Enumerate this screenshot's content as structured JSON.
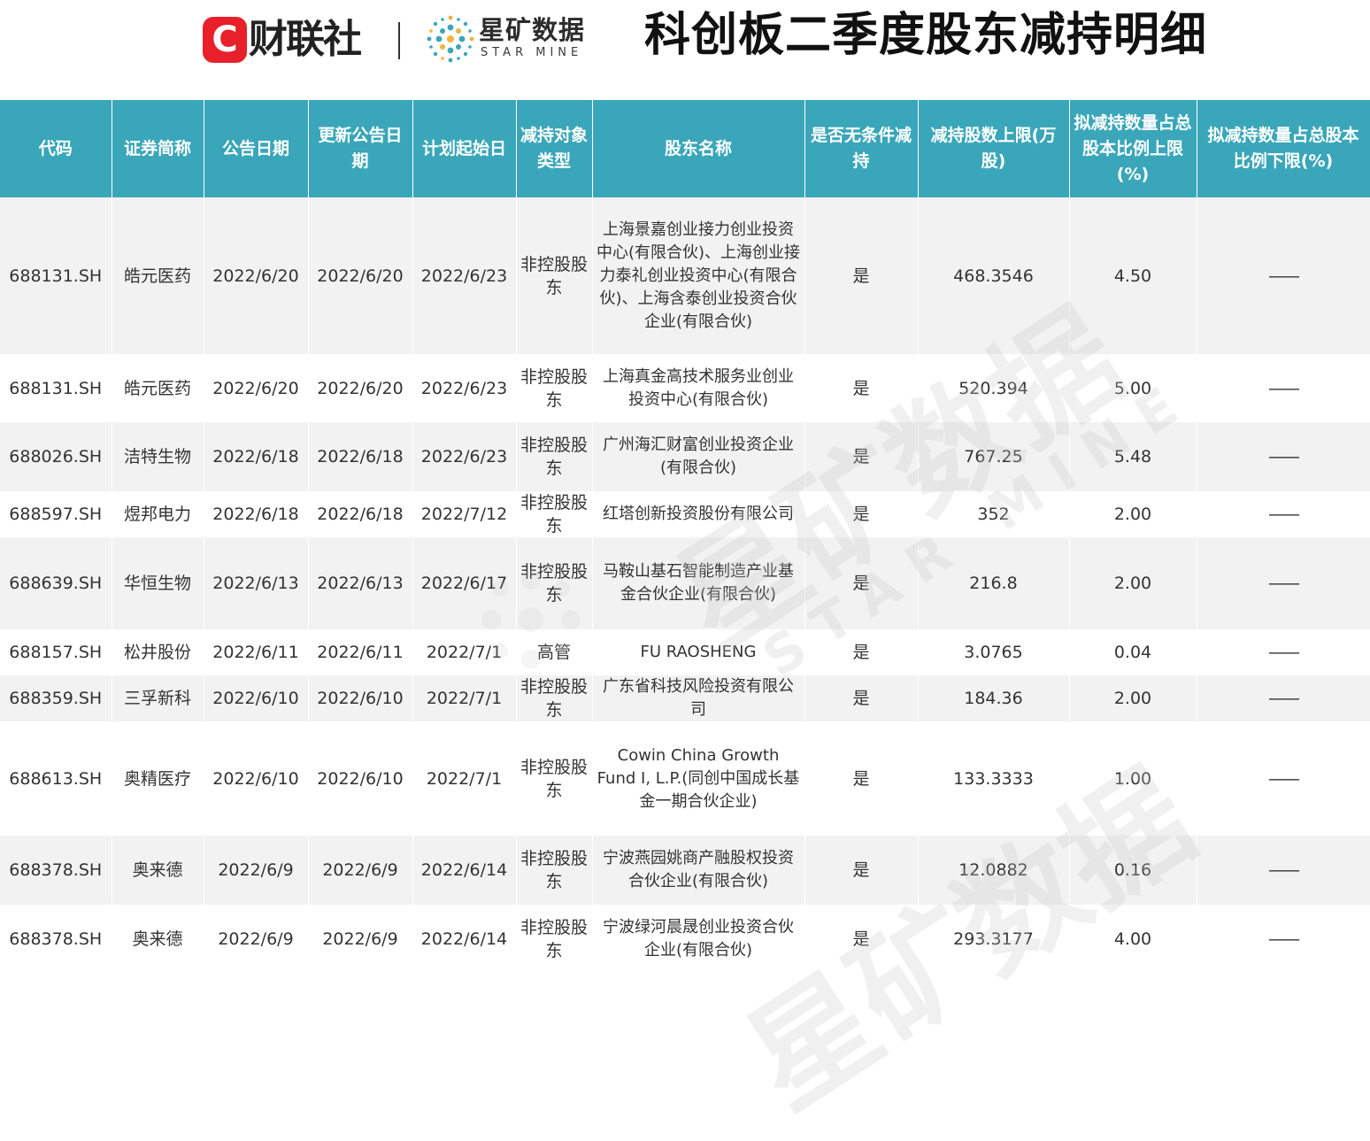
{
  "header": {
    "logo_c": "C",
    "logo_text": "财联社",
    "starmine_cn": "星矿数据",
    "starmine_en": "STAR MINE",
    "title": "科创板二季度股东减持明细"
  },
  "colors": {
    "header_bg": "#3aa6b9",
    "row_alt": "#f2f2f2",
    "logo_red": "#e8202a"
  },
  "table": {
    "columns": [
      "代码",
      "证券简称",
      "公告日期",
      "更新公告日期",
      "计划起始日",
      "减持对象类型",
      "股东名称",
      "是否无条件减持",
      "减持股数上限(万股)",
      "拟减持数量占总股本比例上限(%)",
      "拟减持数量占总股本比例下限(%)"
    ],
    "rows": [
      {
        "code": "688131.SH",
        "name": "皓元医药",
        "announce": "2022/6/20",
        "update": "2022/6/20",
        "start": "2022/6/23",
        "type": "非控股股东",
        "holder": "上海景嘉创业接力创业投资中心(有限合伙)、上海创业接力泰礼创业投资中心(有限合伙)、上海含泰创业投资合伙企业(有限合伙)",
        "unconditional": "是",
        "max_shares": "468.3546",
        "ratio_upper": "4.50",
        "ratio_lower": "——"
      },
      {
        "code": "688131.SH",
        "name": "皓元医药",
        "announce": "2022/6/20",
        "update": "2022/6/20",
        "start": "2022/6/23",
        "type": "非控股股东",
        "holder": "上海真金高技术服务业创业投资中心(有限合伙)",
        "unconditional": "是",
        "max_shares": "520.394",
        "ratio_upper": "5.00",
        "ratio_lower": "——"
      },
      {
        "code": "688026.SH",
        "name": "洁特生物",
        "announce": "2022/6/18",
        "update": "2022/6/18",
        "start": "2022/6/23",
        "type": "非控股股东",
        "holder": "广州海汇财富创业投资企业(有限合伙)",
        "unconditional": "是",
        "max_shares": "767.25",
        "ratio_upper": "5.48",
        "ratio_lower": "——"
      },
      {
        "code": "688597.SH",
        "name": "煜邦电力",
        "announce": "2022/6/18",
        "update": "2022/6/18",
        "start": "2022/7/12",
        "type": "非控股股东",
        "holder": "红塔创新投资股份有限公司",
        "unconditional": "是",
        "max_shares": "352",
        "ratio_upper": "2.00",
        "ratio_lower": "——"
      },
      {
        "code": "688639.SH",
        "name": "华恒生物",
        "announce": "2022/6/13",
        "update": "2022/6/13",
        "start": "2022/6/17",
        "type": "非控股股东",
        "holder": "马鞍山基石智能制造产业基金合伙企业(有限合伙)",
        "unconditional": "是",
        "max_shares": "216.8",
        "ratio_upper": "2.00",
        "ratio_lower": "——"
      },
      {
        "code": "688157.SH",
        "name": "松井股份",
        "announce": "2022/6/11",
        "update": "2022/6/11",
        "start": "2022/7/1",
        "type": "高管",
        "holder": "FU RAOSHENG",
        "unconditional": "是",
        "max_shares": "3.0765",
        "ratio_upper": "0.04",
        "ratio_lower": "——"
      },
      {
        "code": "688359.SH",
        "name": "三孚新科",
        "announce": "2022/6/10",
        "update": "2022/6/10",
        "start": "2022/7/1",
        "type": "非控股股东",
        "holder": "广东省科技风险投资有限公司",
        "unconditional": "是",
        "max_shares": "184.36",
        "ratio_upper": "2.00",
        "ratio_lower": "——"
      },
      {
        "code": "688613.SH",
        "name": "奥精医疗",
        "announce": "2022/6/10",
        "update": "2022/6/10",
        "start": "2022/7/1",
        "type": "非控股股东",
        "holder": "Cowin China Growth Fund I, L.P.(同创中国成长基金一期合伙企业)",
        "unconditional": "是",
        "max_shares": "133.3333",
        "ratio_upper": "1.00",
        "ratio_lower": "——"
      },
      {
        "code": "688378.SH",
        "name": "奥来德",
        "announce": "2022/6/9",
        "update": "2022/6/9",
        "start": "2022/6/14",
        "type": "非控股股东",
        "holder": "宁波燕园姚商产融股权投资合伙企业(有限合伙)",
        "unconditional": "是",
        "max_shares": "12.0882",
        "ratio_upper": "0.16",
        "ratio_lower": "——"
      },
      {
        "code": "688378.SH",
        "name": "奥来德",
        "announce": "2022/6/9",
        "update": "2022/6/9",
        "start": "2022/6/14",
        "type": "非控股股东",
        "holder": "宁波绿河晨晟创业投资合伙企业(有限合伙)",
        "unconditional": "是",
        "max_shares": "293.3177",
        "ratio_upper": "4.00",
        "ratio_lower": "——"
      }
    ]
  },
  "watermark": {
    "cn": "星矿数据",
    "en": "STAR MINE"
  }
}
